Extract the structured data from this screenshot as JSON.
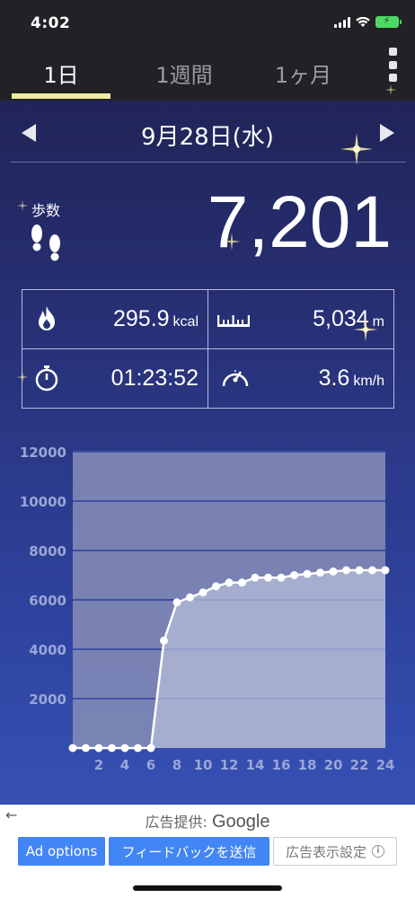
{
  "status_bar": {
    "time": "4:02"
  },
  "tabs": [
    {
      "label": "1日",
      "active": true
    },
    {
      "label": "1週間",
      "active": false
    },
    {
      "label": "1ヶ月",
      "active": false
    }
  ],
  "date": {
    "label": "9月28日(水)"
  },
  "steps": {
    "label": "歩数",
    "value": "7,201"
  },
  "stats": {
    "calories": {
      "value": "295.9",
      "unit": "kcal",
      "icon": "flame-icon"
    },
    "distance": {
      "value": "5,034",
      "unit": "m",
      "icon": "ruler-icon"
    },
    "duration": {
      "value": "01:23:52",
      "unit": "",
      "icon": "stopwatch-icon"
    },
    "speed": {
      "value": "3.6",
      "unit": "km/h",
      "icon": "speedometer-icon"
    }
  },
  "chart_data": {
    "type": "area",
    "x": [
      0,
      1,
      2,
      3,
      4,
      5,
      6,
      7,
      8,
      9,
      10,
      11,
      12,
      13,
      14,
      15,
      16,
      17,
      18,
      19,
      20,
      21,
      22,
      23,
      24
    ],
    "y": [
      0,
      0,
      0,
      0,
      0,
      0,
      0,
      4350,
      5900,
      6100,
      6300,
      6550,
      6700,
      6700,
      6900,
      6900,
      6900,
      7000,
      7050,
      7100,
      7150,
      7200,
      7200,
      7200,
      7201
    ],
    "ylim": [
      0,
      12000
    ],
    "xlim": [
      0,
      24
    ],
    "y_ticks": [
      2000,
      4000,
      6000,
      8000,
      10000,
      12000
    ],
    "y_tick_labels": [
      "2000",
      "4000",
      "6000",
      "8000",
      "10000",
      "12000"
    ],
    "x_ticks": [
      2,
      4,
      6,
      8,
      10,
      12,
      14,
      16,
      18,
      20,
      22,
      24
    ],
    "x_tick_labels": [
      "2",
      "4",
      "6",
      "8",
      "10",
      "12",
      "14",
      "16",
      "18",
      "20",
      "22",
      "24"
    ],
    "grid": true,
    "colors": {
      "line": "#ffffff",
      "fill": "#b9c0dc",
      "plot_bg": "#7d86b4",
      "grid": "#3f51a6",
      "tick_label": "#9aa6d6"
    }
  },
  "ad": {
    "back": "←",
    "provider_prefix": "広告提供:",
    "provider_brand": "Google",
    "ad_options": "Ad options",
    "feedback": "フィードバックを送信",
    "settings": "広告表示設定",
    "info": "i"
  },
  "colors": {
    "tab_underline": "#f3eba0",
    "ad_blue": "#4285f4"
  }
}
